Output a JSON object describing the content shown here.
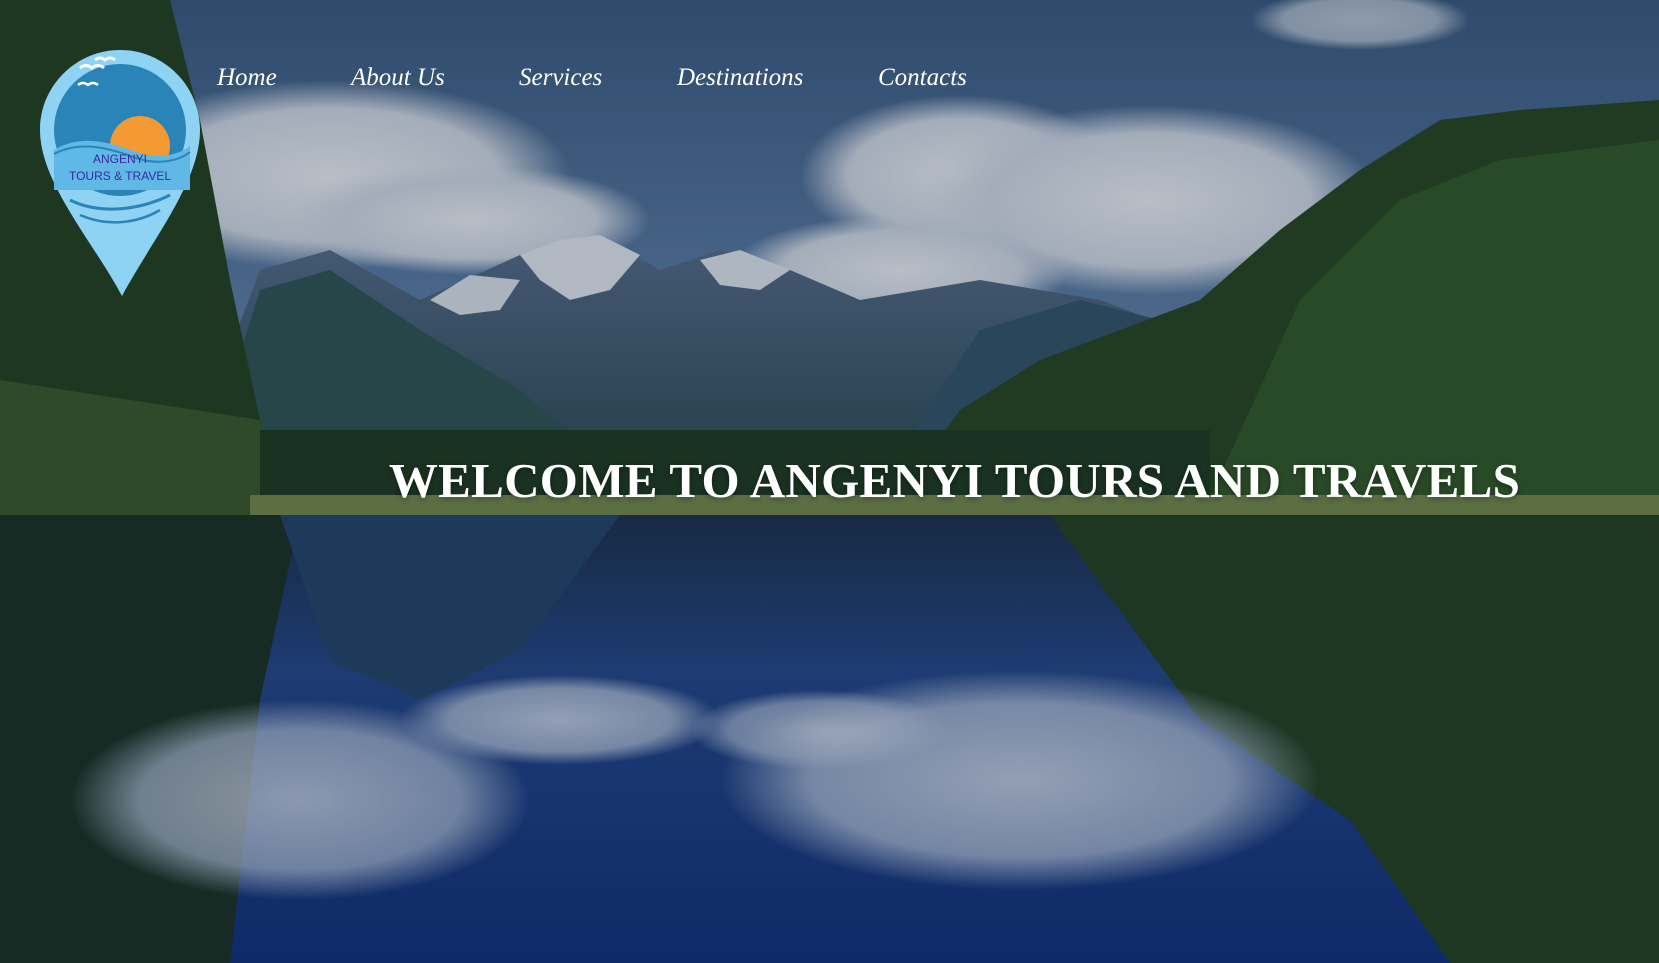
{
  "nav": {
    "items": [
      {
        "label": "Home"
      },
      {
        "label": "About Us"
      },
      {
        "label": "Services"
      },
      {
        "label": "Destinations"
      },
      {
        "label": "Contacts"
      }
    ]
  },
  "logo": {
    "text_line1": "ANGENYI",
    "text_line2": "TOURS & TRAVEL"
  },
  "hero": {
    "headline": "WELCOME TO ANGENYI TOURS AND TRAVELS"
  },
  "colors": {
    "sky_top": "#3f5f86",
    "water": "#163a85",
    "forest": "#24411d",
    "logo_pin": "#8fd3f4",
    "logo_inner": "#2a84b8",
    "logo_sun": "#f39a32",
    "logo_text": "#3a2a9a"
  }
}
